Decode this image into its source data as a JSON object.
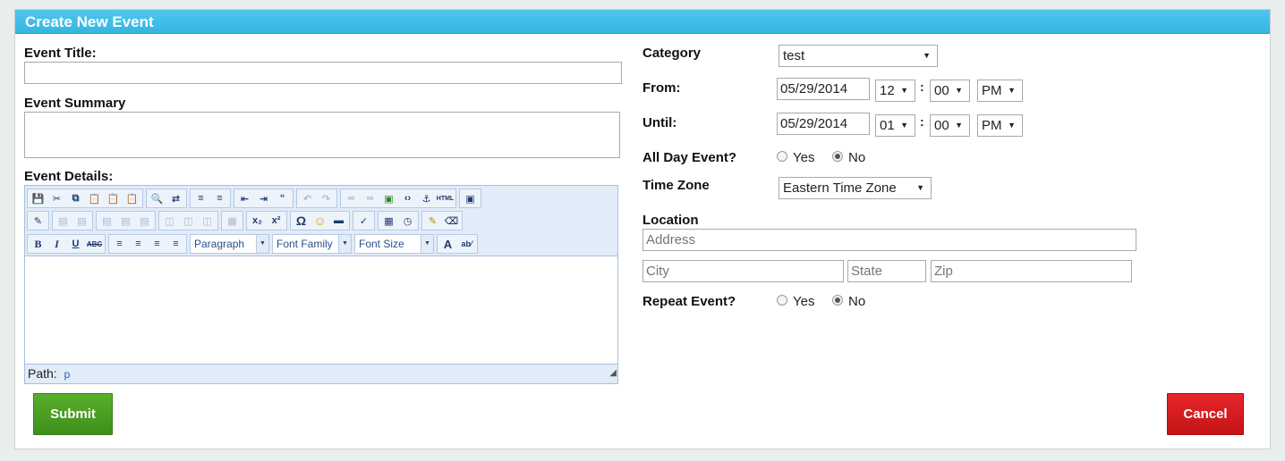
{
  "panel": {
    "title": "Create New Event"
  },
  "left": {
    "title_label": "Event Title:",
    "title_value": "",
    "summary_label": "Event Summary",
    "summary_value": "",
    "details_label": "Event Details:"
  },
  "editor": {
    "dropdowns": {
      "paragraph": "Paragraph",
      "font_family": "Font Family",
      "font_size": "Font Size"
    },
    "status_label": "Path:",
    "status_path": "p",
    "toolbar_icons": [
      "save-icon",
      "cut-icon",
      "copy-icon",
      "paste-icon",
      "paste-text-icon",
      "paste-word-icon",
      "find-icon",
      "replace-icon",
      "bullet-list-icon",
      "numbered-list-icon",
      "outdent-icon",
      "indent-icon",
      "blockquote-icon",
      "undo-icon",
      "redo-icon",
      "link-icon",
      "unlink-icon",
      "image-icon",
      "code-icon",
      "anchor-icon",
      "html-icon",
      "fullscreen-icon",
      "edit-icon",
      "table-icon",
      "subscript-icon",
      "superscript-icon",
      "special-char-icon",
      "emoticon-icon",
      "hr-icon",
      "spellcheck-icon",
      "date-icon",
      "time-icon",
      "cleanup-icon",
      "eraser-icon",
      "bold-icon",
      "italic-icon",
      "underline-icon",
      "strikethrough-icon",
      "align-left-icon",
      "align-center-icon",
      "align-right-icon",
      "justify-icon",
      "text-color-icon",
      "highlight-icon"
    ]
  },
  "right": {
    "category_label": "Category",
    "category_value": "test",
    "from_label": "From:",
    "from_date": "05/29/2014",
    "from_hour": "12",
    "from_minute": "00",
    "from_ampm": "PM",
    "until_label": "Until:",
    "until_date": "05/29/2014",
    "until_hour": "01",
    "until_minute": "00",
    "until_ampm": "PM",
    "time_colon": ":",
    "allday_label": "All Day Event?",
    "allday_yes": "Yes",
    "allday_no": "No",
    "allday_selected": "No",
    "timezone_label": "Time Zone",
    "timezone_value": "Eastern Time Zone",
    "location_label": "Location",
    "address_placeholder": "Address",
    "city_placeholder": "City",
    "state_placeholder": "State",
    "zip_placeholder": "Zip",
    "repeat_label": "Repeat Event?",
    "repeat_yes": "Yes",
    "repeat_no": "No",
    "repeat_selected": "No"
  },
  "buttons": {
    "submit": "Submit",
    "cancel": "Cancel"
  },
  "colors": {
    "header": "#36b5e2",
    "submit": "#4a9e23",
    "cancel": "#d41a1d",
    "editor_toolbar": "#e2ecf8"
  }
}
